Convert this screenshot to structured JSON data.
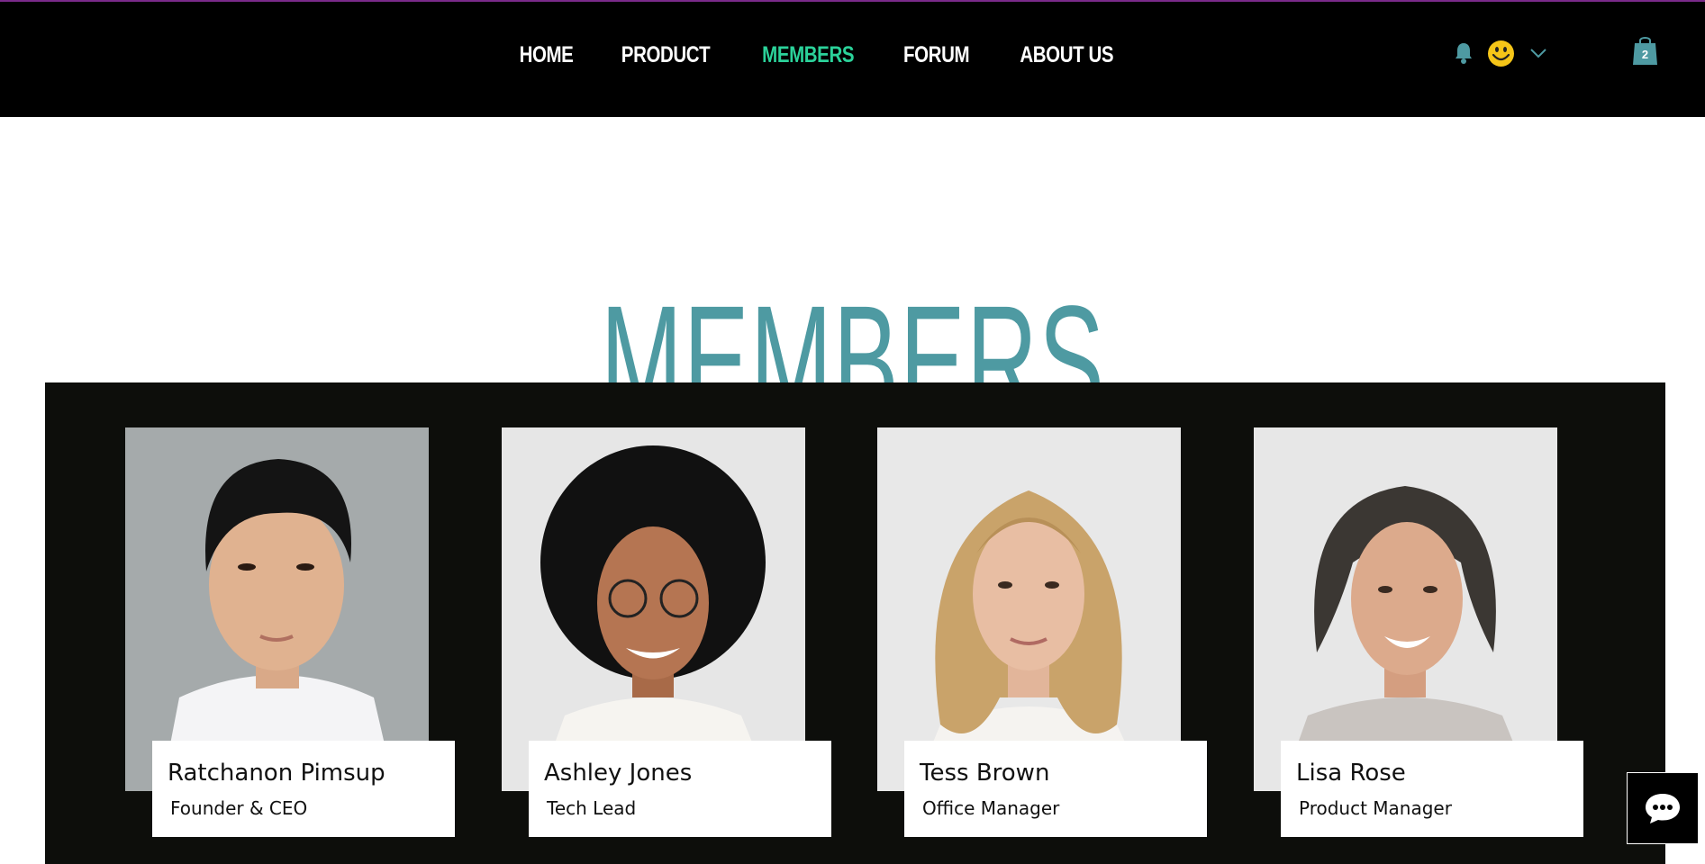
{
  "nav": {
    "items": [
      {
        "label": "HOME",
        "active": false
      },
      {
        "label": "PRODUCT",
        "active": false
      },
      {
        "label": "MEMBERS",
        "active": true
      },
      {
        "label": "FORUM",
        "active": false
      },
      {
        "label": "ABOUT US",
        "active": false
      }
    ],
    "active_color": "#2bd29a"
  },
  "header_icons": {
    "notification": "bell-icon",
    "account": "smiley-avatar-icon",
    "account_menu": "chevron-down-icon",
    "cart": "shopping-bag-icon",
    "cart_count": "2",
    "accent": "#4e9aa2"
  },
  "page": {
    "title": "MEMBERS",
    "title_color": "#4e9aa2"
  },
  "members": [
    {
      "name": "Ratchanon Pimsup",
      "role": "Founder & CEO"
    },
    {
      "name": "Ashley Jones",
      "role": "Tech Lead"
    },
    {
      "name": "Tess Brown",
      "role": "Office Manager"
    },
    {
      "name": "Lisa Rose",
      "role": "Product Manager"
    }
  ],
  "chat": {
    "icon": "chat-bubble-icon"
  }
}
